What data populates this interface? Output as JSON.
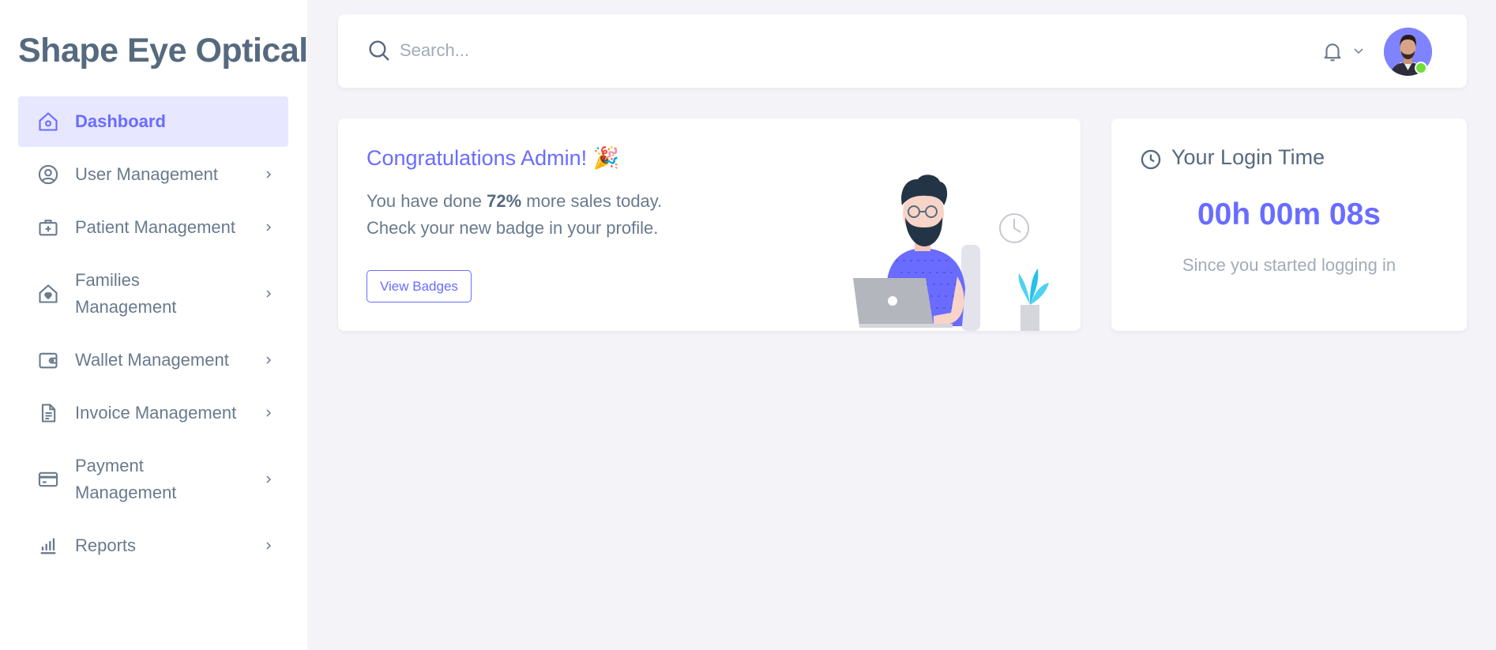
{
  "brand": "Shape Eye Optical",
  "search": {
    "placeholder": "Search..."
  },
  "sidebar": {
    "items": [
      {
        "label": "Dashboard"
      },
      {
        "label": "User Management"
      },
      {
        "label": "Patient Management"
      },
      {
        "label": "Families Management"
      },
      {
        "label": "Wallet Management"
      },
      {
        "label": "Invoice Management"
      },
      {
        "label": "Payment Management"
      },
      {
        "label": "Reports"
      }
    ]
  },
  "congrats": {
    "title": "Congratulations Admin! 🎉",
    "line1_prefix": "You have done ",
    "line1_value": "72%",
    "line1_suffix": " more sales today.",
    "line2": "Check your new badge in your profile.",
    "button": "View Badges"
  },
  "login": {
    "title": "Your Login Time",
    "time": "00h 00m 08s",
    "subtitle": "Since you started logging in"
  },
  "colors": {
    "accent": "#696cff",
    "text": "#566a7f",
    "muted": "#a1acb8",
    "online": "#71dd37"
  },
  "icons": [
    "search-icon",
    "bell-icon",
    "home-icon",
    "user-circle-icon",
    "medkit-icon",
    "home-heart-icon",
    "wallet-icon",
    "document-icon",
    "credit-card-icon",
    "bar-chart-icon",
    "clock-icon",
    "chevron-right-icon"
  ]
}
